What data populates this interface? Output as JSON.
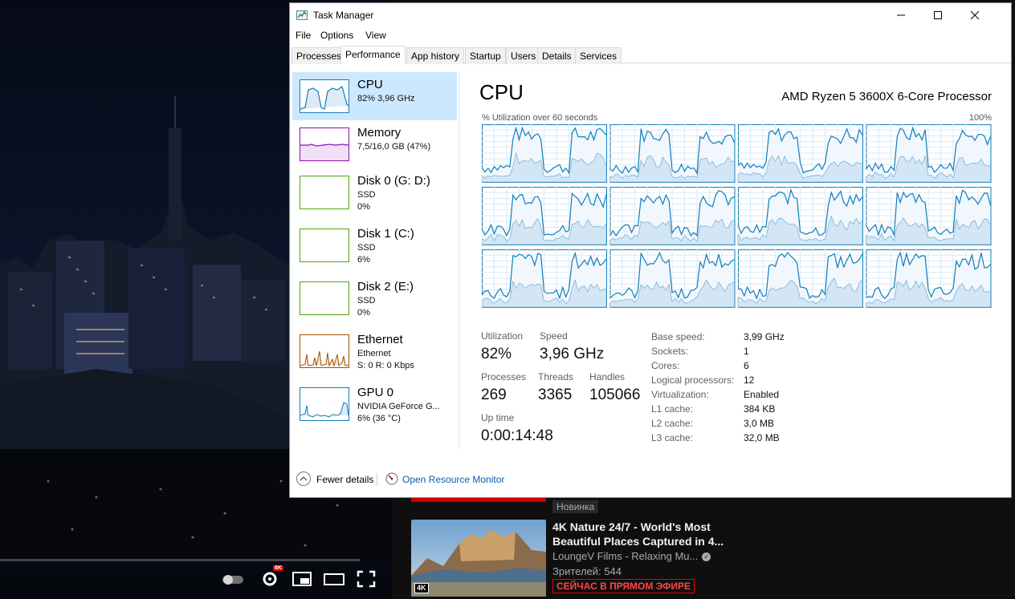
{
  "window": {
    "title": "Task Manager",
    "minimize_icon": "minimize-icon",
    "maximize_icon": "maximize-icon",
    "close_icon": "close-icon"
  },
  "menu": {
    "file": "File",
    "options": "Options",
    "view": "View"
  },
  "tabs": [
    {
      "label": "Processes"
    },
    {
      "label": "Performance",
      "active": true
    },
    {
      "label": "App history"
    },
    {
      "label": "Startup"
    },
    {
      "label": "Users"
    },
    {
      "label": "Details"
    },
    {
      "label": "Services"
    }
  ],
  "sidebar": {
    "cpu": {
      "name": "CPU",
      "line1": "82% 3,96 GHz",
      "color": "#117dbb"
    },
    "memory": {
      "name": "Memory",
      "line1": "7,5/16,0 GB (47%)",
      "color": "#8b12ae"
    },
    "disk0": {
      "name": "Disk 0 (G: D:)",
      "line1": "SSD",
      "line2": "0%",
      "color": "#4da60c"
    },
    "disk1": {
      "name": "Disk 1 (C:)",
      "line1": "SSD",
      "line2": "6%",
      "color": "#4da60c"
    },
    "disk2": {
      "name": "Disk 2 (E:)",
      "line1": "SSD",
      "line2": "0%",
      "color": "#4da60c"
    },
    "ethernet": {
      "name": "Ethernet",
      "line1": "Ethernet",
      "line2": "S: 0 R: 0 Kbps",
      "color": "#a74f01"
    },
    "gpu0": {
      "name": "GPU 0",
      "line1": "NVIDIA GeForce G...",
      "line2": "6% (36 °C)",
      "color": "#117dbb"
    }
  },
  "cpu": {
    "title": "CPU",
    "model": "AMD Ryzen 5 3600X 6-Core Processor",
    "graph_label": "% Utilization over 60 seconds",
    "graph_max": "100%",
    "graph_color": "#117dbb",
    "stats": {
      "utilization_label": "Utilization",
      "utilization": "82%",
      "speed_label": "Speed",
      "speed": "3,96 GHz",
      "processes_label": "Processes",
      "processes": "269",
      "threads_label": "Threads",
      "threads": "3365",
      "handles_label": "Handles",
      "handles": "105066",
      "uptime_label": "Up time",
      "uptime": "0:00:14:48"
    },
    "specs": [
      {
        "label": "Base speed:",
        "value": "3,99 GHz"
      },
      {
        "label": "Sockets:",
        "value": "1"
      },
      {
        "label": "Cores:",
        "value": "6"
      },
      {
        "label": "Logical processors:",
        "value": "12"
      },
      {
        "label": "Virtualization:",
        "value": "Enabled"
      },
      {
        "label": "L1 cache:",
        "value": "384 KB"
      },
      {
        "label": "L2 cache:",
        "value": "3,0 MB"
      },
      {
        "label": "L3 cache:",
        "value": "32,0 MB"
      }
    ]
  },
  "footer": {
    "fewer_details": "Fewer details",
    "open_resource_monitor": "Open Resource Monitor"
  },
  "youtube": {
    "new_badge": "Новинка",
    "video": {
      "title": "4K Nature 24/7 - World's Most Beautiful Places Captured in 4...",
      "channel": "LoungeV Films - Relaxing Mu...",
      "viewers": "Зрителей: 544",
      "live_badge": "СЕЙЧАС В ПРЯМОМ ЭФИРЕ",
      "quality_badge": "4K"
    },
    "player_quality_badge": "8K"
  }
}
